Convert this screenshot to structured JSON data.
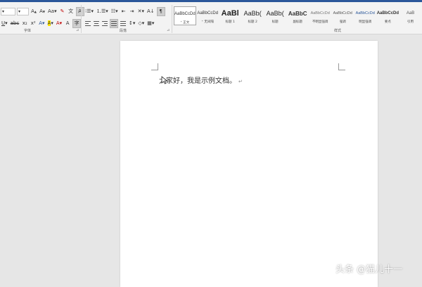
{
  "font_group": {
    "size_value": "",
    "font_name": "",
    "label": "字体",
    "case_label": "Aa",
    "highlight_label": "A",
    "font_color_label": "A"
  },
  "paragraph_group": {
    "label": "段落"
  },
  "styles_group": {
    "label": "样式",
    "items": [
      {
        "preview": "AaBbCcDd",
        "name": "⁺ 正文",
        "selected": true
      },
      {
        "preview": "AaBbCcDd",
        "name": "⁺ 无间隔",
        "selected": false
      },
      {
        "preview": "AaBl",
        "name": "标题 1",
        "selected": false
      },
      {
        "preview": "AaBb(",
        "name": "标题 2",
        "selected": false
      },
      {
        "preview": "AaBb(",
        "name": "标题",
        "selected": false
      },
      {
        "preview": "AaBbC",
        "name": "副标题",
        "selected": false
      },
      {
        "preview": "AaBbCcDd",
        "name": "不明显强调",
        "selected": false
      },
      {
        "preview": "AaBbCcDd",
        "name": "强调",
        "selected": false
      },
      {
        "preview": "AaBbCcDd",
        "name": "明显强调",
        "selected": false
      },
      {
        "preview": "AaBbCcDd",
        "name": "要点",
        "selected": false
      },
      {
        "preview": "AaB",
        "name": "引用",
        "selected": false
      }
    ]
  },
  "document": {
    "text": "大家好，我是示例文档。",
    "para_mark": "↵"
  },
  "watermark": "头条 @猫儿十一",
  "colors": {
    "accent": "#2b579a",
    "font_red": "#c00000",
    "highlight": "#ffe600"
  }
}
